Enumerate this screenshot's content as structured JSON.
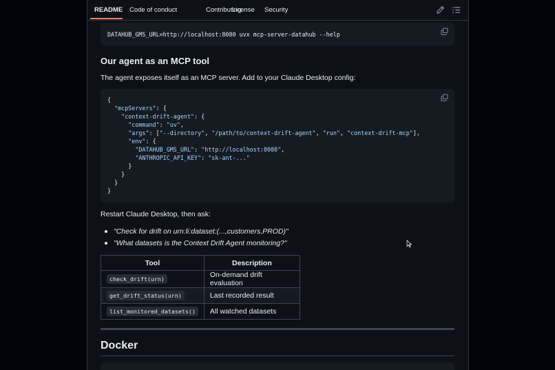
{
  "tabs": [
    {
      "label": "README",
      "active": true
    },
    {
      "label": "Code of conduct"
    },
    {
      "label": "Contributing"
    },
    {
      "label": "License"
    },
    {
      "label": "Security"
    }
  ],
  "toolbar_icons": [
    "pencil-icon",
    "list-icon"
  ],
  "top_command": "DATAHUB_GMS_URL=http://localhost:8080 uvx mcp-server-datahub --help",
  "mcp_section": {
    "heading": "Our agent as an MCP tool",
    "intro": "The agent exposes itself as an MCP server. Add to your Claude Desktop config:",
    "config_lines": [
      "{",
      "  \"mcpServers\": {",
      "    \"context-drift-agent\": {",
      "      \"command\": \"uv\",",
      "      \"args\": [\"--directory\", \"/path/to/context-drift-agent\", \"run\", \"context-drift-mcp\"],",
      "      \"env\": {",
      "        \"DATAHUB_GMS_URL\": \"http://localhost:8080\",",
      "        \"ANTHROPIC_API_KEY\": \"sk-ant-...\"",
      "      }",
      "    }",
      "  }",
      "}"
    ],
    "after_text": "Restart Claude Desktop, then ask:",
    "questions": [
      "\"Check for drift on urn:li:dataset:(...,customers,PROD)\"",
      "\"What datasets is the Context Drift Agent monitoring?\""
    ]
  },
  "tools_table": {
    "headers": [
      "Tool",
      "Description"
    ],
    "rows": [
      {
        "tool": "check_drift(urn)",
        "description": "On-demand drift evaluation"
      },
      {
        "tool": "get_drift_status(urn)",
        "description": "Last recorded result"
      },
      {
        "tool": "list_monitored_datasets()",
        "description": "All watched datasets"
      }
    ]
  },
  "docker_heading": "Docker",
  "colors": {
    "page_bg": "#0d1117",
    "code_bg": "#161b22",
    "border": "#30363d",
    "accent_underline": "#f78166",
    "json_key": "#a5d6ff"
  }
}
